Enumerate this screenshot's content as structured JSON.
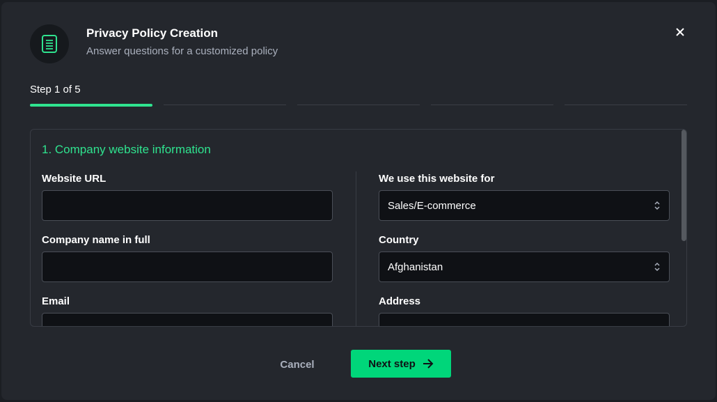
{
  "header": {
    "title": "Privacy Policy Creation",
    "subtitle": "Answer questions for a customized policy",
    "icon": "document-icon"
  },
  "progress": {
    "label": "Step 1 of 5",
    "current_step": 1,
    "total_steps": 5
  },
  "section": {
    "title": "1. Company website information"
  },
  "fields": {
    "website_url": {
      "label": "Website URL",
      "value": ""
    },
    "company_name": {
      "label": "Company name in full",
      "value": ""
    },
    "email": {
      "label": "Email",
      "value": ""
    },
    "website_use": {
      "label": "We use this website for",
      "value": "Sales/E-commerce"
    },
    "country": {
      "label": "Country",
      "value": "Afghanistan"
    },
    "address": {
      "label": "Address",
      "value": ""
    }
  },
  "footer": {
    "cancel_label": "Cancel",
    "next_label": "Next step"
  },
  "colors": {
    "accent": "#2fe38f",
    "button": "#00d67a",
    "background": "#24272d"
  }
}
